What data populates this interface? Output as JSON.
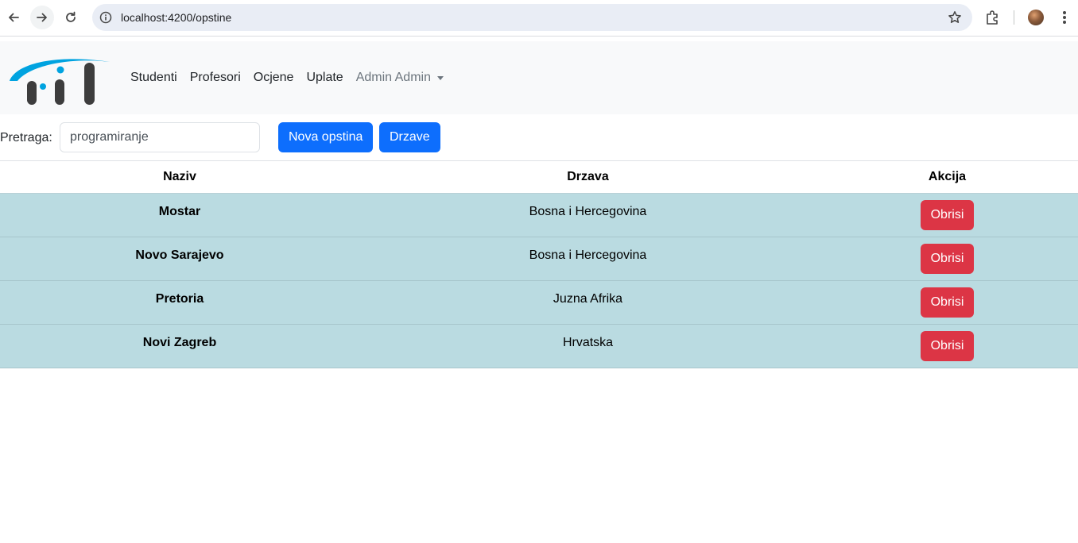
{
  "browser": {
    "url": "localhost:4200/opstine"
  },
  "navbar": {
    "links": [
      "Studenti",
      "Profesori",
      "Ocjene",
      "Uplate"
    ],
    "user_dropdown": "Admin Admin"
  },
  "search": {
    "label": "Pretraga:",
    "value": "programiranje",
    "new_button": "Nova opstina",
    "states_button": "Drzave"
  },
  "table": {
    "headers": [
      "Naziv",
      "Drzava",
      "Akcija"
    ],
    "rows": [
      {
        "naziv": "Mostar",
        "drzava": "Bosna i Hercegovina",
        "action": "Obrisi"
      },
      {
        "naziv": "Novo Sarajevo",
        "drzava": "Bosna i Hercegovina",
        "action": "Obrisi"
      },
      {
        "naziv": "Pretoria",
        "drzava": "Juzna Afrika",
        "action": "Obrisi"
      },
      {
        "naziv": "Novi Zagreb",
        "drzava": "Hrvatska",
        "action": "Obrisi"
      }
    ]
  },
  "colors": {
    "primary": "#0d6efd",
    "danger": "#dc3545",
    "row_bg": "#badbe1",
    "navbar_bg": "#f8f9fa",
    "logo_blue": "#00a3e0",
    "logo_dark": "#3d3d3d"
  }
}
